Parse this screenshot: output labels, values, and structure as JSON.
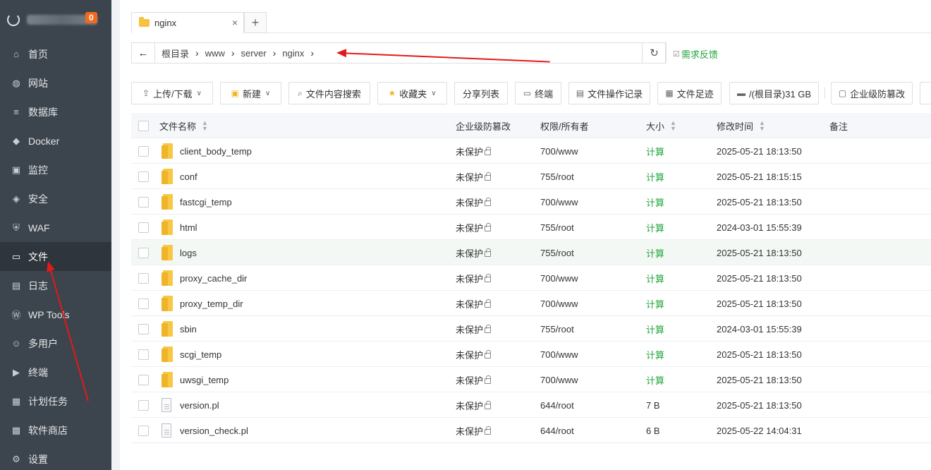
{
  "sidebar": {
    "badge": "0",
    "items": [
      {
        "label": "首页",
        "icon": "home-icon",
        "glyph": "⌂"
      },
      {
        "label": "网站",
        "icon": "globe-icon",
        "glyph": "◍"
      },
      {
        "label": "数据库",
        "icon": "database-icon",
        "glyph": "≡"
      },
      {
        "label": "Docker",
        "icon": "docker-icon",
        "glyph": "◆"
      },
      {
        "label": "监控",
        "icon": "monitor-icon",
        "glyph": "▣"
      },
      {
        "label": "安全",
        "icon": "shield-icon",
        "glyph": "◈"
      },
      {
        "label": "WAF",
        "icon": "waf-icon",
        "glyph": "⛨"
      },
      {
        "label": "文件",
        "icon": "folder-icon",
        "glyph": "▭"
      },
      {
        "label": "日志",
        "icon": "log-icon",
        "glyph": "▤"
      },
      {
        "label": "WP Tools",
        "icon": "wordpress-icon",
        "glyph": "Ⓦ"
      },
      {
        "label": "多用户",
        "icon": "users-icon",
        "glyph": "☺"
      },
      {
        "label": "终端",
        "icon": "terminal-icon",
        "glyph": "▶"
      },
      {
        "label": "计划任务",
        "icon": "calendar-icon",
        "glyph": "▦"
      },
      {
        "label": "软件商店",
        "icon": "apps-icon",
        "glyph": "▩"
      },
      {
        "label": "设置",
        "icon": "gear-icon",
        "glyph": "⚙"
      }
    ],
    "active": "文件"
  },
  "tab": {
    "label": "nginx",
    "close": "×",
    "add": "+"
  },
  "path": {
    "back": "←",
    "crumbs": [
      "根目录",
      "www",
      "server",
      "nginx"
    ],
    "sep": "›",
    "refresh": "↻",
    "feedback": "需求反馈"
  },
  "toolbar": {
    "upload": "上传/下载",
    "new": "新建",
    "content_search": "文件内容搜索",
    "favorites": "收藏夹",
    "share_list": "分享列表",
    "terminal": "终端",
    "op_log": "文件操作记录",
    "footprint": "文件足迹",
    "disk": "/(根目录)31 GB",
    "enterprise": "企业级防篡改"
  },
  "table": {
    "headers": {
      "name": "文件名称",
      "tamper": "企业级防篡改",
      "perm": "权限/所有者",
      "size": "大小",
      "mtime": "修改时间",
      "note": "备注"
    },
    "rows": [
      {
        "name": "client_body_temp",
        "type": "folder",
        "tamper": "未保护",
        "perm": "700/www",
        "size": "计算",
        "mtime": "2025-05-21 18:13:50"
      },
      {
        "name": "conf",
        "type": "folder",
        "tamper": "未保护",
        "perm": "755/root",
        "size": "计算",
        "mtime": "2025-05-21 18:15:15"
      },
      {
        "name": "fastcgi_temp",
        "type": "folder",
        "tamper": "未保护",
        "perm": "700/www",
        "size": "计算",
        "mtime": "2025-05-21 18:13:50"
      },
      {
        "name": "html",
        "type": "folder",
        "tamper": "未保护",
        "perm": "755/root",
        "size": "计算",
        "mtime": "2024-03-01 15:55:39"
      },
      {
        "name": "logs",
        "type": "folder",
        "tamper": "未保护",
        "perm": "755/root",
        "size": "计算",
        "mtime": "2025-05-21 18:13:50"
      },
      {
        "name": "proxy_cache_dir",
        "type": "folder",
        "tamper": "未保护",
        "perm": "700/www",
        "size": "计算",
        "mtime": "2025-05-21 18:13:50"
      },
      {
        "name": "proxy_temp_dir",
        "type": "folder",
        "tamper": "未保护",
        "perm": "700/www",
        "size": "计算",
        "mtime": "2025-05-21 18:13:50"
      },
      {
        "name": "sbin",
        "type": "folder",
        "tamper": "未保护",
        "perm": "755/root",
        "size": "计算",
        "mtime": "2024-03-01 15:55:39"
      },
      {
        "name": "scgi_temp",
        "type": "folder",
        "tamper": "未保护",
        "perm": "700/www",
        "size": "计算",
        "mtime": "2025-05-21 18:13:50"
      },
      {
        "name": "uwsgi_temp",
        "type": "folder",
        "tamper": "未保护",
        "perm": "700/www",
        "size": "计算",
        "mtime": "2025-05-21 18:13:50"
      },
      {
        "name": "version.pl",
        "type": "file",
        "tamper": "未保护",
        "perm": "644/root",
        "size": "7 B",
        "mtime": "2025-05-21 18:13:50"
      },
      {
        "name": "version_check.pl",
        "type": "file",
        "tamper": "未保护",
        "perm": "644/root",
        "size": "6 B",
        "mtime": "2025-05-22 14:04:31"
      }
    ]
  },
  "colors": {
    "accent": "#20a53a",
    "sidebar": "#3c444d",
    "annotation": "#e31a1a"
  }
}
